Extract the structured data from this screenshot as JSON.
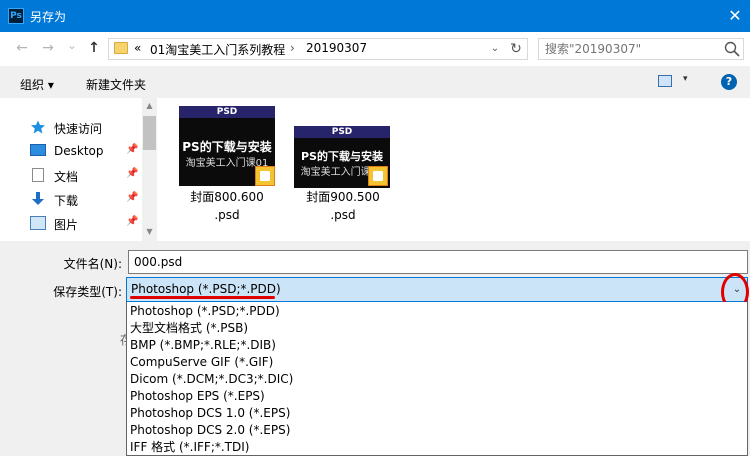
{
  "window": {
    "title": "另存为",
    "app_icon": "ps-icon",
    "close": "✕"
  },
  "nav": {
    "back": "←",
    "forward": "→",
    "recent": "⌄",
    "up": "↑",
    "path_prefix": "«",
    "breadcrumb": [
      "01淘宝美工入门系列教程",
      "20190307"
    ],
    "sep": "›",
    "dropdown": "⌄",
    "refresh": "↻",
    "search_placeholder": "搜索\"20190307\""
  },
  "toolbar": {
    "organize": "组织 ▾",
    "new_folder": "新建文件夹",
    "view_dd": "▾",
    "help": "?"
  },
  "sidebar": {
    "items": [
      {
        "label": "快速访问",
        "icon": "star-icon",
        "pinned": false
      },
      {
        "label": "Desktop",
        "icon": "desktop-icon",
        "pinned": true
      },
      {
        "label": "文档",
        "icon": "document-icon",
        "pinned": true
      },
      {
        "label": "下载",
        "icon": "download-icon",
        "pinned": true
      },
      {
        "label": "图片",
        "icon": "pictures-icon",
        "pinned": true
      }
    ],
    "pin_glyph": "📌",
    "scroll_up": "▲",
    "scroll_down": "▼"
  },
  "files": [
    {
      "name_line1": "封面800.600",
      "name_line2": ".psd",
      "thumb_band": "PSD",
      "thumb_title": "PS的下载与安装",
      "thumb_sub": "淘宝美工入门课01"
    },
    {
      "name_line1": "封面900.500",
      "name_line2": ".psd",
      "thumb_band": "PSD",
      "thumb_title": "PS的下载与安装",
      "thumb_sub": "淘宝美工入门课01"
    }
  ],
  "form": {
    "filename_label": "文件名(N):",
    "filename_value": "000.psd",
    "type_label": "保存类型(T):",
    "type_value": "Photoshop (*.PSD;*.PDD)",
    "type_dd": "⌄",
    "hidden_label": "存"
  },
  "type_options": [
    "Photoshop (*.PSD;*.PDD)",
    "大型文档格式 (*.PSB)",
    "BMP (*.BMP;*.RLE;*.DIB)",
    "CompuServe GIF (*.GIF)",
    "Dicom (*.DCM;*.DC3;*.DIC)",
    "Photoshop EPS (*.EPS)",
    "Photoshop DCS 1.0 (*.EPS)",
    "Photoshop DCS 2.0 (*.EPS)",
    "IFF 格式 (*.IFF;*.TDI)"
  ],
  "colors": {
    "titlebar": "#0078d7",
    "selection": "#cce4f7",
    "annotation": "#e00000"
  }
}
